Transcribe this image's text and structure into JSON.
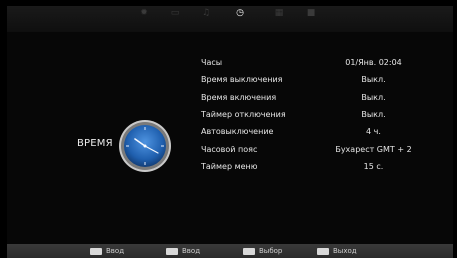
{
  "top_tabs": [
    {
      "icon": "gear-icon",
      "active": false
    },
    {
      "icon": "monitor-icon",
      "active": false
    },
    {
      "icon": "music-note-icon",
      "active": false
    },
    {
      "icon": "clock-icon",
      "active": true
    },
    {
      "icon": "grid-icon",
      "active": false
    },
    {
      "icon": "lock-icon",
      "active": false
    }
  ],
  "section": {
    "title": "ВРЕМЯ",
    "icon": "clock-icon"
  },
  "settings": [
    {
      "label": "Часы",
      "value": "01/Янв.   02:04"
    },
    {
      "label": "Время выключения",
      "value": "Выкл."
    },
    {
      "label": "Время включения",
      "value": "Выкл."
    },
    {
      "label": "Таймер отключения",
      "value": "Выкл."
    },
    {
      "label": "Автовыключение",
      "value": "4 ч."
    },
    {
      "label": "Часовой пояс",
      "value": "Бухарест GMT + 2"
    },
    {
      "label": "Таймер меню",
      "value": "15 с."
    }
  ],
  "hints": [
    {
      "key_icon": "enter-key-icon",
      "label": "Ввод"
    },
    {
      "key_icon": "menu-key-icon",
      "label": "Ввод"
    },
    {
      "key_icon": "arrows-key-icon",
      "label": "Выбор"
    },
    {
      "key_icon": "exit-key-icon",
      "label": "Выход"
    }
  ],
  "colors": {
    "accent": "#2f77c9",
    "clock_face": "#1f5fae",
    "text": "#e6e6e6",
    "bar": "#2f2f2f"
  }
}
